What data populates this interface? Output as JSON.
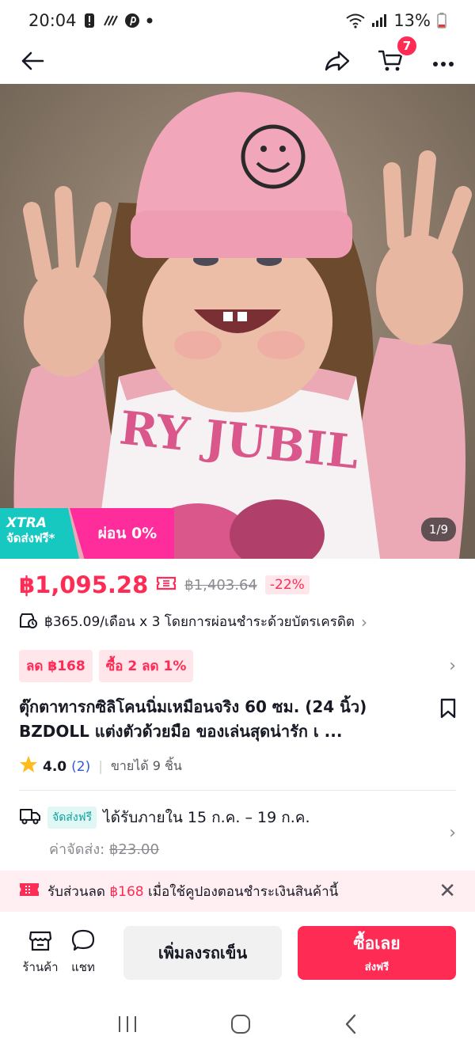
{
  "status_bar": {
    "time": "20:04",
    "battery": "13%"
  },
  "nav": {
    "cart_count": "7"
  },
  "hero": {
    "xtra_title": "XTRA",
    "xtra_sub": "จัดส่งฟรี*",
    "installment_badge": "ผ่อน 0%",
    "page_counter": "1/9"
  },
  "price": {
    "current": "฿1,095.28",
    "original": "฿1,403.64",
    "discount": "-22%"
  },
  "installment": {
    "text": "฿365.09/เดือน x 3 โดยการผ่อนชำระด้วยบัตรเครดิต"
  },
  "promos": [
    "ลด ฿168",
    "ซื้อ 2 ลด 1%"
  ],
  "product": {
    "title": "ตุ๊กตาทารกซิลิโคนนิ่มเหมือนจริง 60 ซม. (24 นิ้ว) BZDOLL แต่งตัวด้วยมือ ของเล่นสุดน่ารัก เ ..."
  },
  "rating": {
    "value": "4.0",
    "count": "(2)",
    "sold": "ขายได้ 9 ชิ้น"
  },
  "shipping": {
    "free_tag": "จัดส่งฟรี",
    "delivery": "ได้รับภายใน 15 ก.ค. – 19 ก.ค.",
    "fee_label": "ค่าจัดส่ง:",
    "fee_old": "฿23.00"
  },
  "coupon": {
    "prefix": "รับส่วนลด",
    "amount": "฿168",
    "suffix": "เมื่อใช้คูปองตอนชำระเงินสินค้านี้"
  },
  "actions": {
    "shop": "ร้านค้า",
    "chat": "แชท",
    "add_to_cart": "เพิ่มลงรถเข็น",
    "buy_now": "ซื้อเลย",
    "buy_now_sub": "ส่งฟรี"
  },
  "colors": {
    "accent": "#fe2c55",
    "teal": "#17c8c0",
    "pink": "#ff2c9c"
  }
}
